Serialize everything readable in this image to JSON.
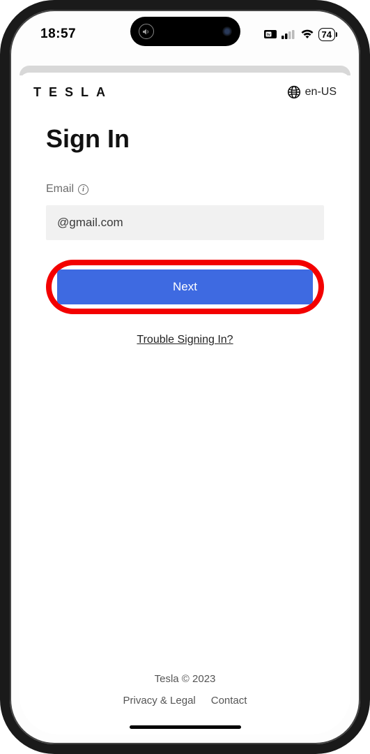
{
  "status": {
    "time": "18:57",
    "battery": "74"
  },
  "topbar": {
    "logo": "T E S L A",
    "locale": "en-US"
  },
  "page": {
    "heading": "Sign In",
    "email_label": "Email",
    "email_value_visible": "@gmail.com",
    "next_button": "Next",
    "trouble_link": "Trouble Signing In?"
  },
  "footer": {
    "copyright": "Tesla © 2023",
    "privacy": "Privacy & Legal",
    "contact": "Contact"
  }
}
